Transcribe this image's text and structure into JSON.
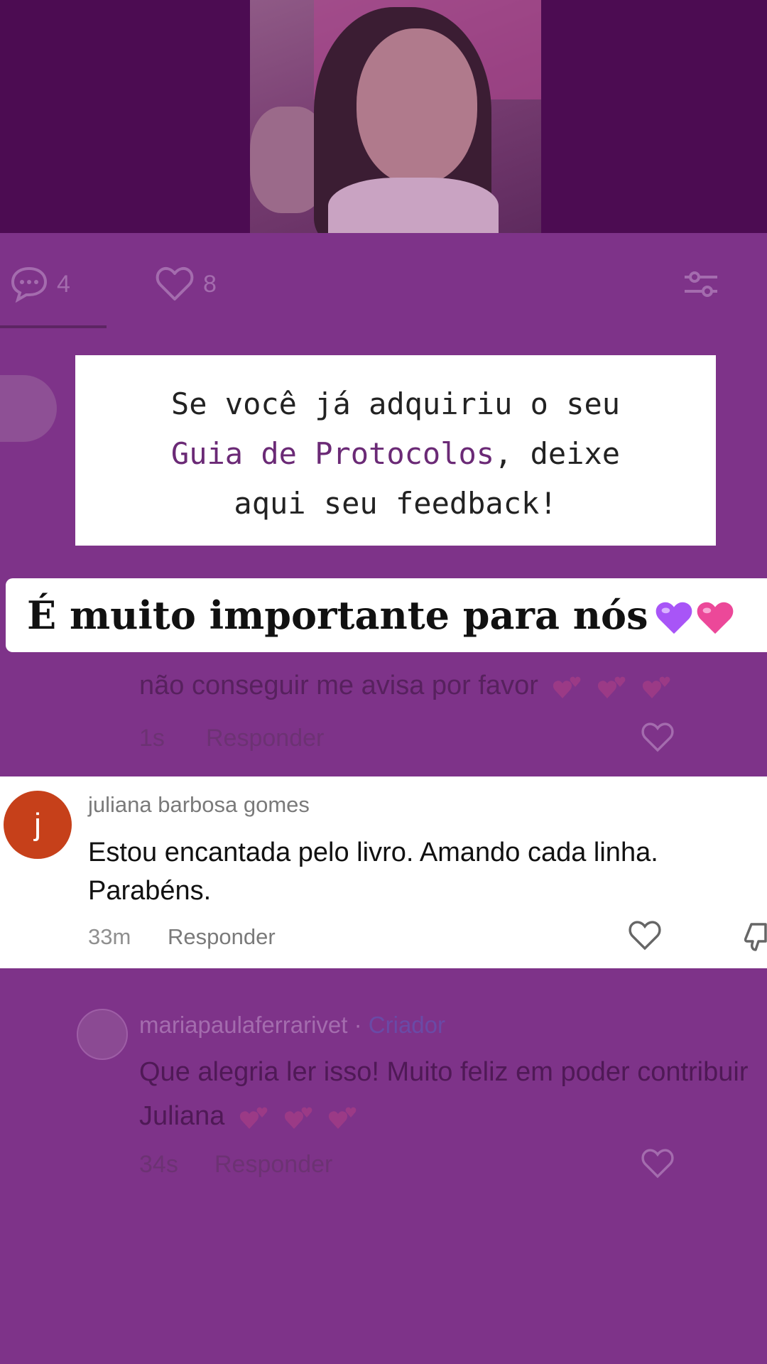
{
  "stats": {
    "comments_count": "4",
    "likes_count": "8"
  },
  "overlay": {
    "card_line1": "Se você já adquiriu o seu",
    "card_highlight": "Guia de Protocolos",
    "card_line2_rest": ", deixe",
    "card_line3": "aqui seu feedback!",
    "banner_text": "É muito importante para nós"
  },
  "background_comment": {
    "text": "não conseguir me avisa por favor",
    "time": "1s",
    "reply_label": "Responder"
  },
  "highlighted_comment": {
    "avatar_letter": "j",
    "username": "juliana barbosa gomes",
    "text": "Estou encantada pelo livro. Amando cada linha. Parabéns.",
    "time": "33m",
    "reply_label": "Responder"
  },
  "creator_reply": {
    "username": "mariapaulaferrarivet",
    "separator": " · ",
    "tag": "Criador",
    "text": "Que alegria ler isso! Muito feliz em poder contribuir Juliana",
    "time": "34s",
    "reply_label": "Responder"
  },
  "colors": {
    "background": "#7e3389",
    "top_band": "#4c0c52",
    "highlight_text": "#6b2a76",
    "avatar_j": "#c6401a"
  },
  "icons": [
    "comment-icon",
    "heart-icon",
    "filter-icon",
    "dislike-icon",
    "purple-heart-emoji",
    "pink-heart-emoji",
    "two-hearts-emoji"
  ]
}
